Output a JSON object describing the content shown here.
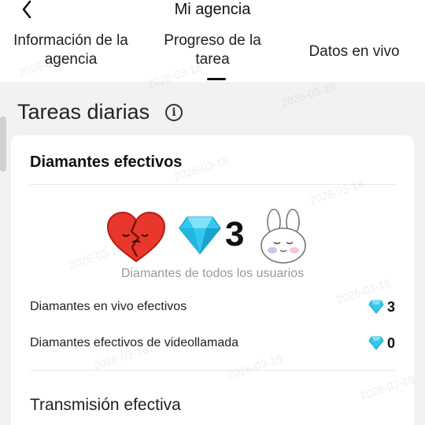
{
  "header": {
    "title": "Mi agencia",
    "back_icon": "chevron-left-icon"
  },
  "tabs": [
    {
      "label_line1": "Información de la",
      "label_line2": "agencia"
    },
    {
      "label_line1": "Progreso de la",
      "label_line2": "tarea",
      "active": true
    },
    {
      "label_line1": "Datos en vivo"
    }
  ],
  "section": {
    "title": "Tareas diarias",
    "info_icon": "info-icon"
  },
  "card": {
    "title": "Diamantes efectivos",
    "total_count": "3",
    "total_caption": "Diamantes de todos los usuarios",
    "rows": [
      {
        "label": "Diamantes en vivo efectivos",
        "value": "3"
      },
      {
        "label": "Diamantes efectivos de videollamada",
        "value": "0"
      }
    ],
    "sub_title": "Transmisión efectiva"
  },
  "watermark": "2026-03-18",
  "colors": {
    "diamond": "#35c8ee",
    "heart": "#e8382b",
    "accent_text": "#111111",
    "caption": "#9a9a9a"
  }
}
